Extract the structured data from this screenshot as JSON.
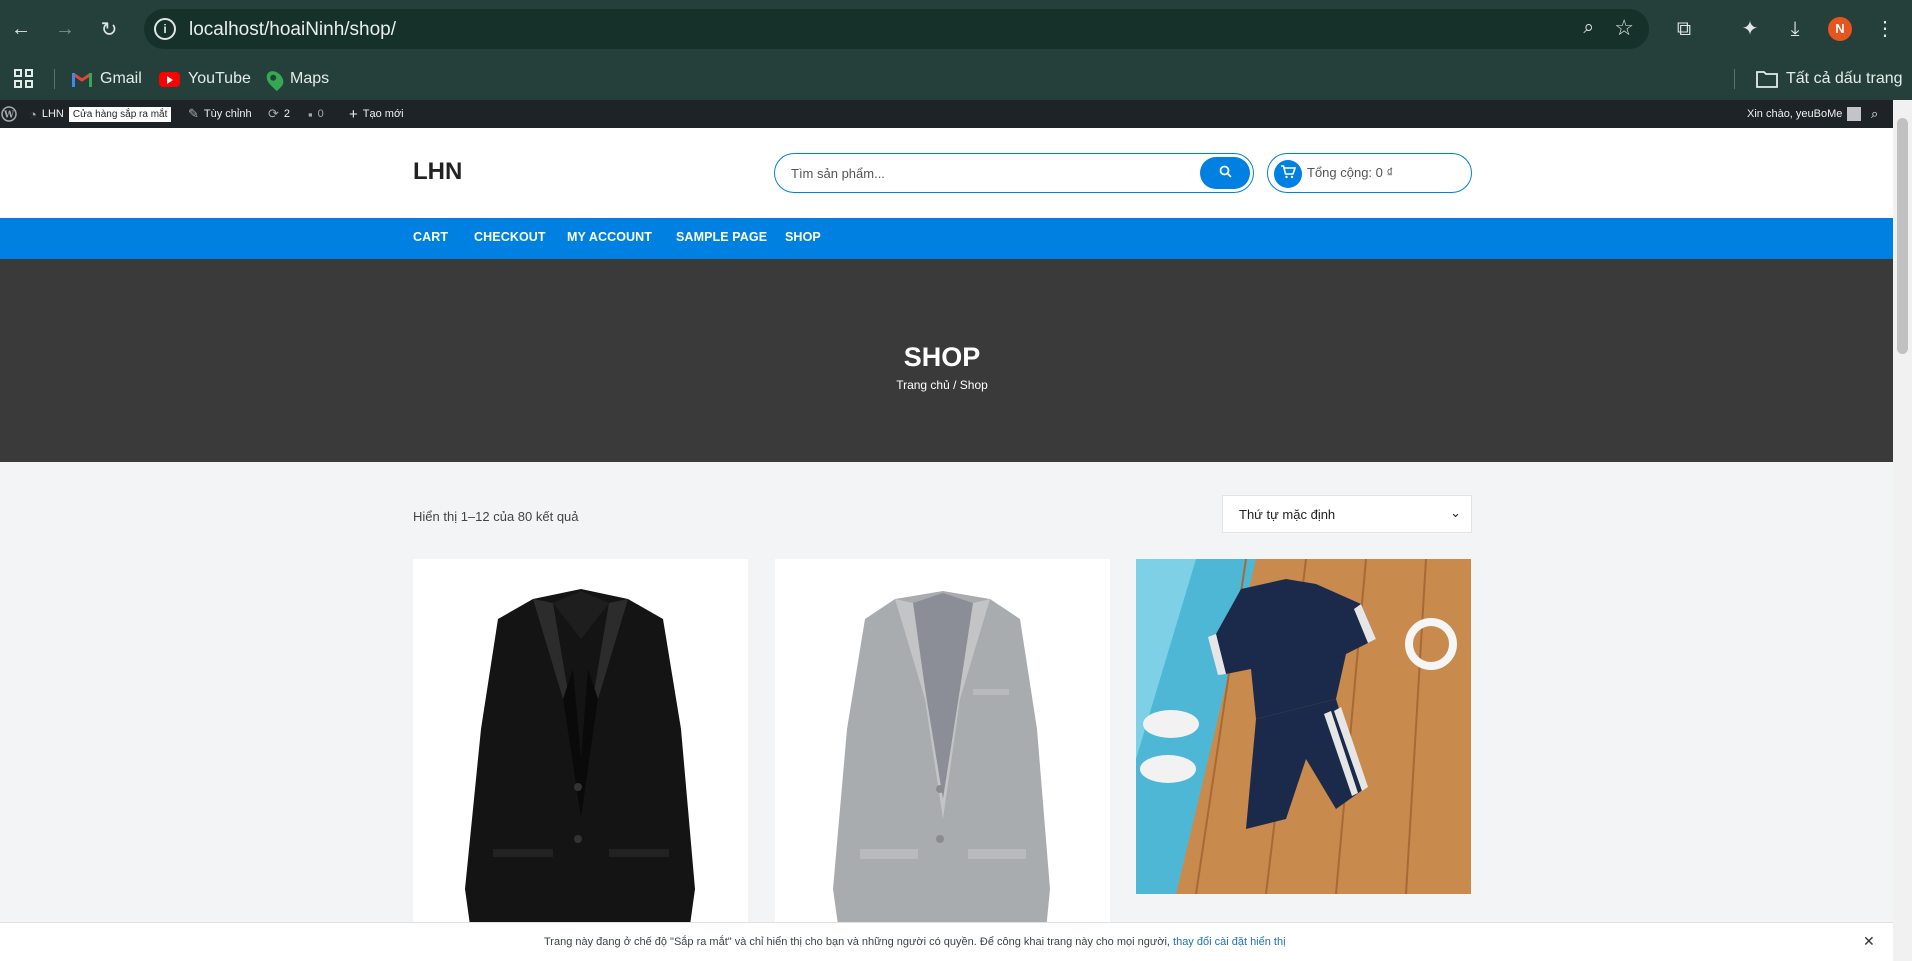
{
  "browser": {
    "url": "localhost/hoaiNinh/shop/",
    "profile_initial": "N",
    "bookmarks": [
      {
        "label": "Gmail",
        "icon": "gmail-icon"
      },
      {
        "label": "YouTube",
        "icon": "youtube-icon"
      },
      {
        "label": "Maps",
        "icon": "maps-icon"
      }
    ],
    "all_bookmarks_label": "Tất cả dấu trang"
  },
  "adminbar": {
    "site_name": "LHN",
    "coming_soon_badge": "Cửa hàng sắp ra mắt",
    "customize": "Tùy chỉnh",
    "updates_count": "2",
    "comments_count": "0",
    "new": "Tạo mới",
    "greeting": "Xin chào, yeuBoMe"
  },
  "header": {
    "site_title": "LHN",
    "search_placeholder": "Tìm sản phẩm...",
    "cart_total": "Tổng cộng: 0 ₫"
  },
  "nav": {
    "items": [
      "CART",
      "CHECKOUT",
      "MY ACCOUNT",
      "SAMPLE PAGE",
      "SHOP"
    ]
  },
  "hero": {
    "title": "SHOP",
    "breadcrumb": "Trang chủ / Shop"
  },
  "shop": {
    "result_count": "Hiển thị 1–12 của 80 kết quả",
    "orderby_selected": "Thứ tự mặc định",
    "products": [
      {
        "image": "black-blazer"
      },
      {
        "image": "grey-blazer"
      },
      {
        "image": "navy-polo-shorts-set"
      }
    ]
  },
  "notice": {
    "message": "Trang này đang ở chế độ \"Sắp ra mắt\" và chỉ hiển thị cho bạn và những người có quyền. Để công khai trang này cho mọi người,",
    "link": "thay đổi cài đặt hiển thị"
  },
  "colors": {
    "chrome_bg": "#25403a",
    "primary_blue": "#0080e0",
    "hero_bg": "#3a3a3a",
    "adminbar_bg": "#1d2327"
  }
}
